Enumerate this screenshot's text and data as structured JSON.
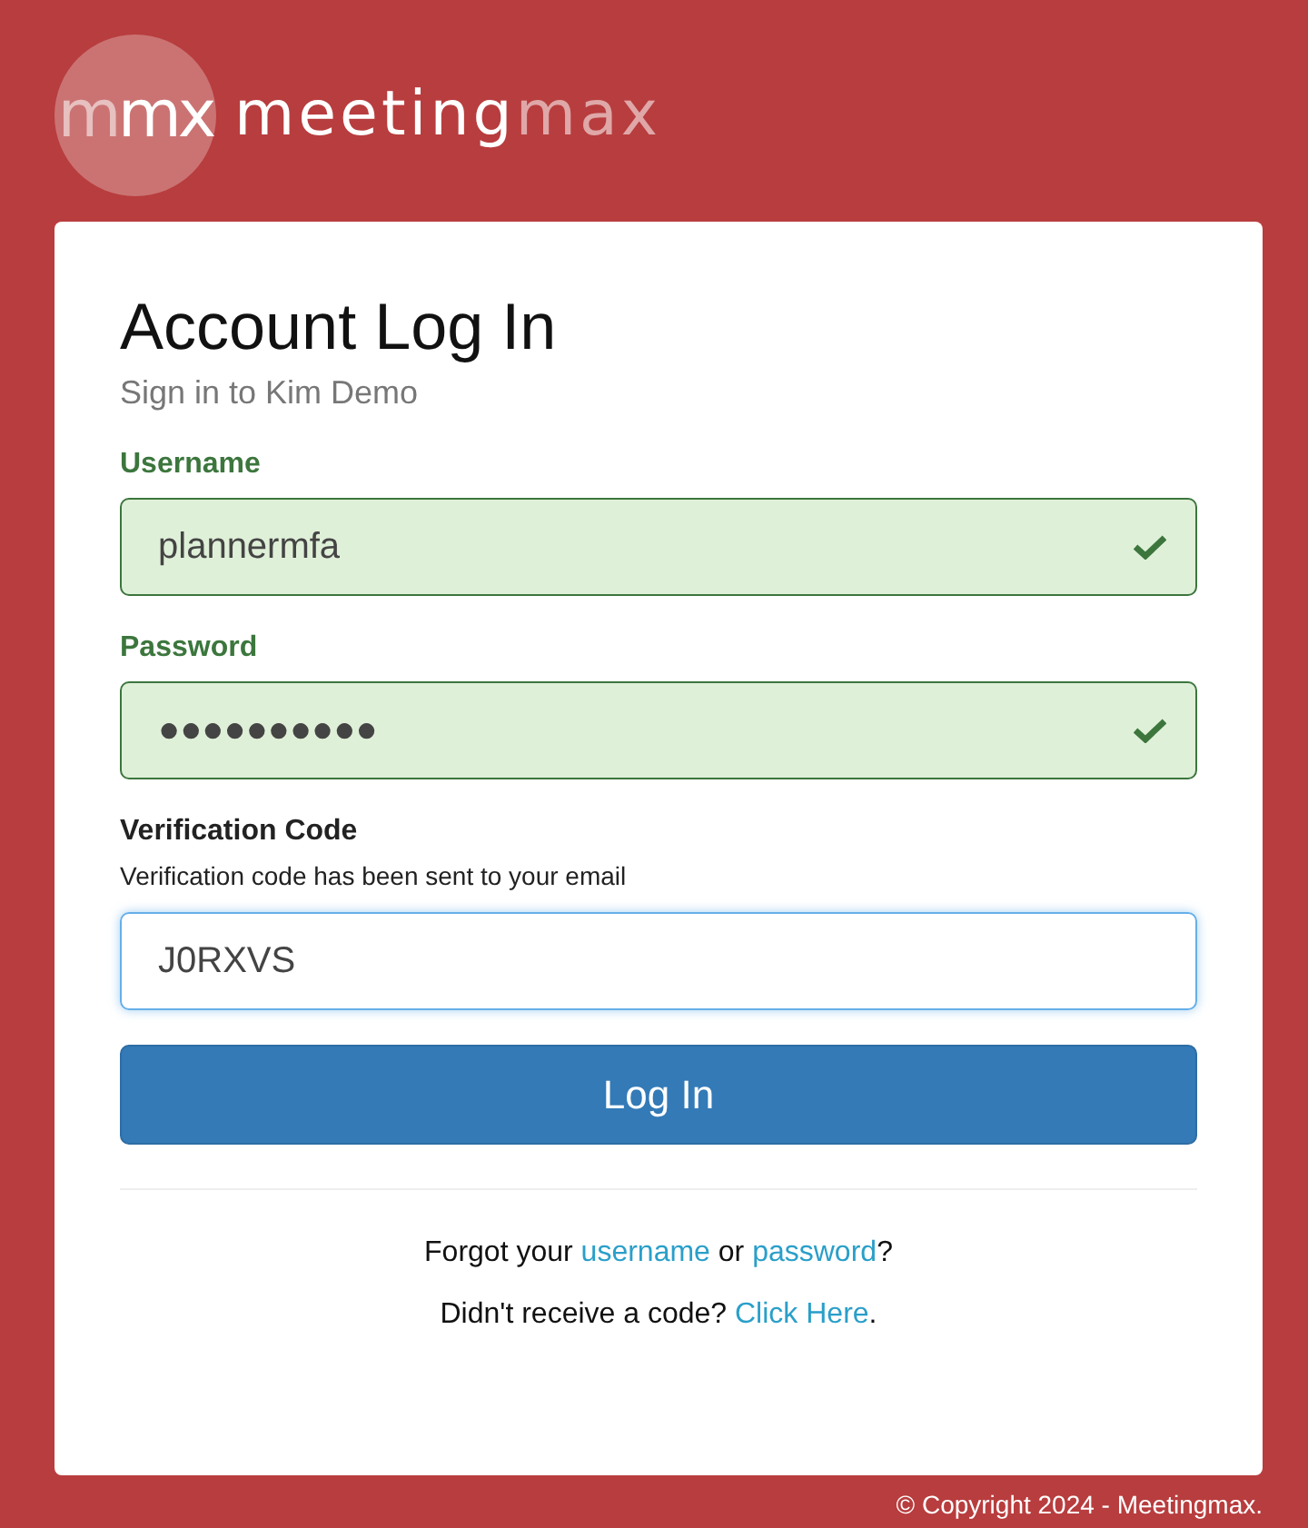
{
  "logo": {
    "mark": [
      {
        "text": "m",
        "faded": true
      },
      {
        "text": "mx",
        "faded": false
      }
    ],
    "wordmark": [
      {
        "text": "meeting",
        "faded": false
      },
      {
        "text": "max",
        "faded": true
      }
    ]
  },
  "title": "Account Log In",
  "subtitle": "Sign in to Kim Demo",
  "fields": [
    {
      "label": "Username",
      "value": "plannermfa",
      "valid": true,
      "focused": false
    },
    {
      "label": "Password",
      "value": "●●●●●●●●●●",
      "valid": true,
      "focused": false
    },
    {
      "label": "Verification Code",
      "help": "Verification code has been sent to your email",
      "value": "J0RXVS",
      "valid": false,
      "focused": true
    }
  ],
  "submit": "Log In",
  "links": [
    [
      {
        "kind": "text",
        "text": "Forgot your "
      },
      {
        "kind": "link",
        "text": "username"
      },
      {
        "kind": "text",
        "text": " or "
      },
      {
        "kind": "link",
        "text": "password"
      },
      {
        "kind": "text",
        "text": "?"
      }
    ],
    [
      {
        "kind": "text",
        "text": "Didn't receive a code? "
      },
      {
        "kind": "link",
        "text": "Click Here"
      },
      {
        "kind": "text",
        "text": "."
      }
    ]
  ],
  "footer": "© Copyright 2024 - Meetingmax."
}
